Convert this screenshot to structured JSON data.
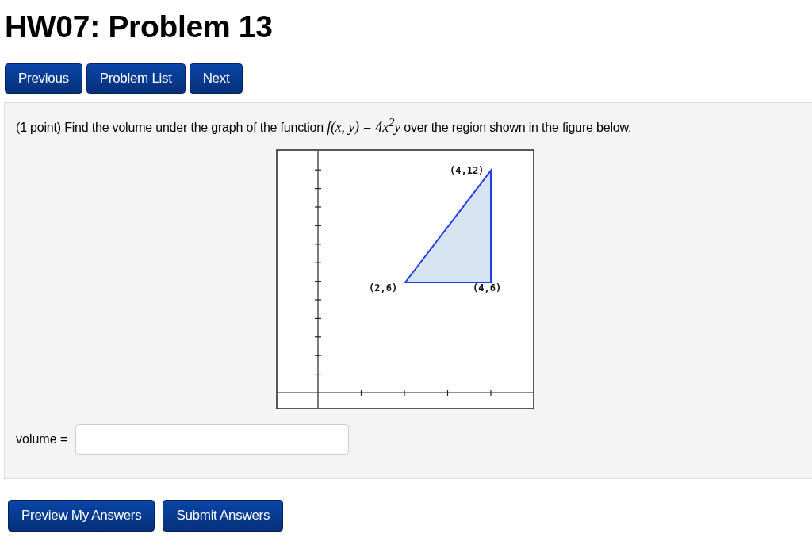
{
  "title": "HW07: Problem 13",
  "nav_buttons": [
    "Previous",
    "Problem List",
    "Next"
  ],
  "problem": {
    "text_start": "(1 point) Find the volume under the graph of the function",
    "formula": "f(x, y) = 4x$^{2}$y",
    "text_end": "over the region shown in the figure below.",
    "figure": {
      "point_labels": [
        "(4,12)",
        "(2,6)",
        "(4,6)"
      ]
    },
    "answer": {
      "label": "volume ="
    }
  },
  "submit_buttons": [
    "Preview My Answers",
    "Submit Answers"
  ]
}
